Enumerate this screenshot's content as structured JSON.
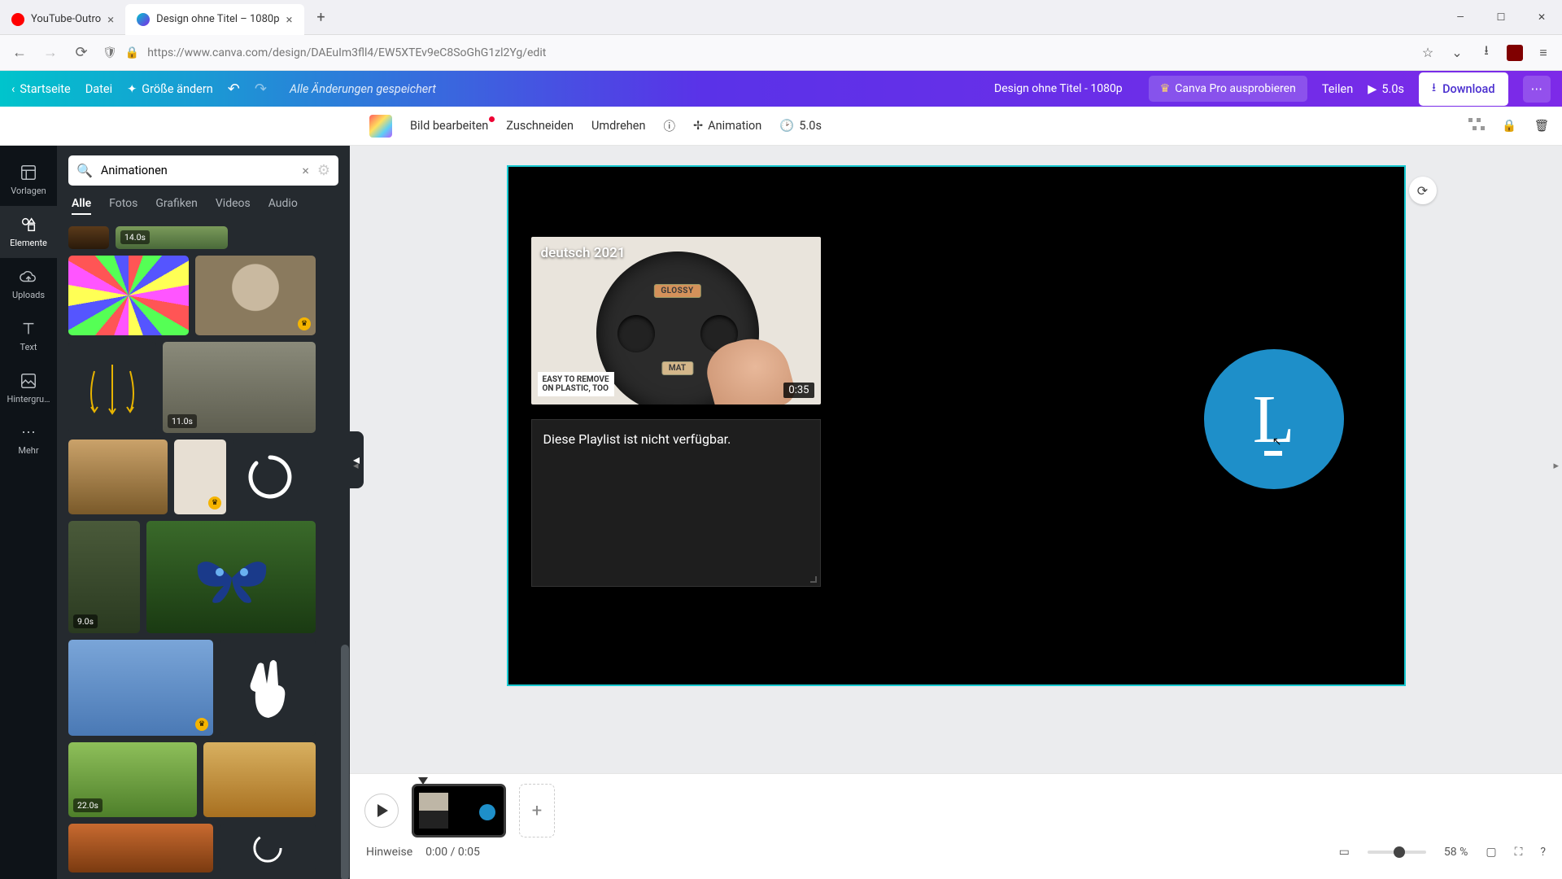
{
  "browser": {
    "tabs": [
      {
        "title": "YouTube-Outro"
      },
      {
        "title": "Design ohne Titel – 1080p"
      }
    ],
    "url": "https://www.canva.com/design/DAEuIm3fll4/EW5XTEv9eC8SoGhG1zl2Yg/edit"
  },
  "canva_top": {
    "home": "Startseite",
    "file": "Datei",
    "resize": "Größe ändern",
    "status": "Alle Änderungen gespeichert",
    "doc_title": "Design ohne Titel - 1080p",
    "try_pro": "Canva Pro ausprobieren",
    "share": "Teilen",
    "play_duration": "5.0s",
    "download": "Download"
  },
  "context": {
    "edit_image": "Bild bearbeiten",
    "crop": "Zuschneiden",
    "flip": "Umdrehen",
    "animation": "Animation",
    "duration": "5.0s"
  },
  "rail": {
    "templates": "Vorlagen",
    "elements": "Elemente",
    "uploads": "Uploads",
    "text": "Text",
    "background": "Hintergru…",
    "more": "Mehr"
  },
  "panel": {
    "search_value": "Animationen",
    "tabs": {
      "all": "Alle",
      "photos": "Fotos",
      "graphics": "Grafiken",
      "videos": "Videos",
      "audio": "Audio"
    },
    "durations": {
      "d1": "14.0s",
      "d2": "11.0s",
      "d3": "9.0s",
      "d4": "22.0s"
    }
  },
  "canvas": {
    "video_title": "deutsch 2021",
    "glossy": "GLOSSY",
    "mat": "MAT",
    "caption_l1": "EASY TO REMOVE",
    "caption_l2": "ON PLASTIC, TOO",
    "timestamp": "0:35",
    "playlist_msg": "Diese Playlist ist nicht verfügbar.",
    "avatar_letter": "L"
  },
  "timeline": {
    "notes": "Hinweise",
    "time": "0:00 / 0:05",
    "zoom": "58 %"
  }
}
